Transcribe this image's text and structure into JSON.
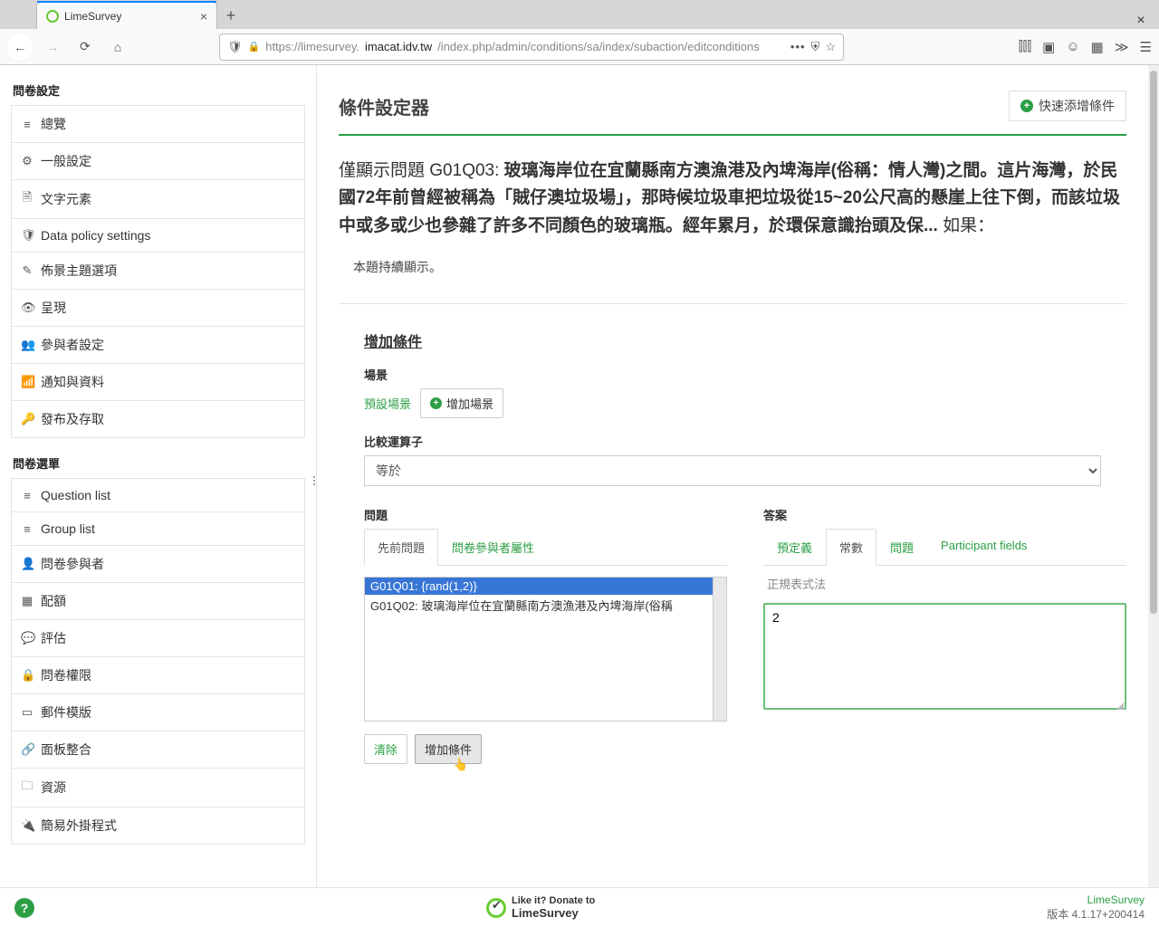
{
  "browser": {
    "tab_title": "LimeSurvey",
    "url_display_prefix": "https://limesurvey.",
    "url_display_domain": "imacat.idv.tw",
    "url_display_path": "/index.php/admin/conditions/sa/index/subaction/editconditions"
  },
  "sidebar": {
    "group1_title": "問卷設定",
    "group1": [
      {
        "label": "總覽",
        "icon": "≡"
      },
      {
        "label": "一般設定",
        "icon": "⚙"
      },
      {
        "label": "文字元素",
        "icon": "🗎"
      },
      {
        "label": "Data policy settings",
        "icon": "🛡"
      },
      {
        "label": "佈景主題選項",
        "icon": "✎"
      },
      {
        "label": "呈現",
        "icon": "👁"
      },
      {
        "label": "參與者設定",
        "icon": "👥"
      },
      {
        "label": "通知與資料",
        "icon": "📶"
      },
      {
        "label": "發布及存取",
        "icon": "🔑"
      }
    ],
    "group2_title": "問卷選單",
    "group2": [
      {
        "label": "Question list",
        "icon": "≡"
      },
      {
        "label": "Group list",
        "icon": "≡"
      },
      {
        "label": "問卷參與者",
        "icon": "👤"
      },
      {
        "label": "配額",
        "icon": "▦"
      },
      {
        "label": "評估",
        "icon": "💬"
      },
      {
        "label": "問卷權限",
        "icon": "🔒"
      },
      {
        "label": "郵件模版",
        "icon": "▭"
      },
      {
        "label": "面板整合",
        "icon": "🔗"
      },
      {
        "label": "資源",
        "icon": "🗀"
      },
      {
        "label": "簡易外掛程式",
        "icon": "🔌"
      }
    ]
  },
  "main": {
    "page_title": "條件設定器",
    "quick_add": "快速添增條件",
    "q_prefix": "僅顯示問題 G01Q03: ",
    "q_body": "玻璃海岸位在宜蘭縣南方澳漁港及內埤海岸(俗稱：情人灣)之間。這片海灣，於民國72年前曾經被稱為「賊仔澳垃圾場」，那時候垃圾車把垃圾從15~20公尺高的懸崖上往下倒，而該垃圾中或多或少也參雜了許多不同顏色的玻璃瓶。經年累月，於環保意識抬頭及保... ",
    "q_suffix": "如果：",
    "subnote": "本題持續顯示。",
    "add_cond_title": "增加條件",
    "scenario_label": "場景",
    "default_scenario": "預設場景",
    "add_scenario": "增加場景",
    "operator_label": "比較運算子",
    "operator_value": "等於",
    "question_label": "問題",
    "answer_label": "答案",
    "q_tabs": [
      {
        "label": "先前問題",
        "active": true
      },
      {
        "label": "問卷參與者屬性",
        "active": false
      }
    ],
    "q_options": [
      {
        "text": "G01Q01: {rand(1,2)}",
        "selected": true
      },
      {
        "text": "G01Q02: 玻璃海岸位在宜蘭縣南方澳漁港及內埤海岸(俗稱",
        "selected": false
      }
    ],
    "a_tabs": [
      {
        "label": "預定義",
        "active": false
      },
      {
        "label": "常數",
        "active": true
      },
      {
        "label": "問題",
        "active": false
      },
      {
        "label": "Participant fields",
        "active": false
      }
    ],
    "regex_label": "正規表式法",
    "answer_value": "2",
    "clear_btn": "清除",
    "submit_btn": "增加條件"
  },
  "footer": {
    "donate1": "Like it? Donate to",
    "donate2": "LimeSurvey",
    "name": "LimeSurvey",
    "version": "版本 4.1.17+200414"
  }
}
